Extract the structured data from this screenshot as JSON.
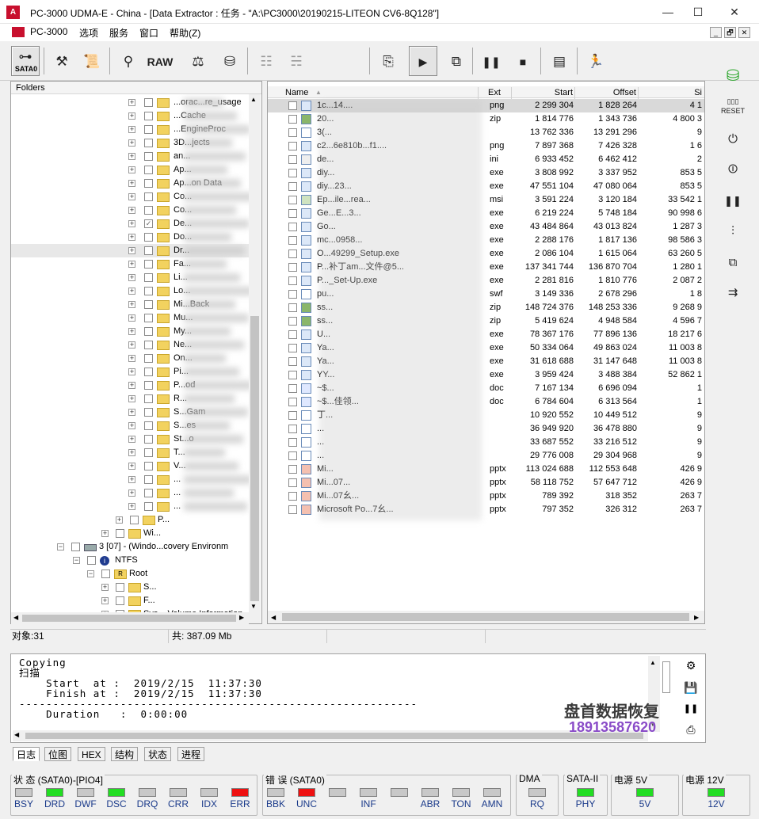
{
  "window": {
    "title": "PC-3000 UDMA-E - China - [Data Extractor : 任务 - \"A:\\PC3000\\20190215-LITEON CV6-8Q128\"]",
    "minimize": "—",
    "maximize": "☐",
    "close": "✕"
  },
  "menu": {
    "items": [
      "PC-3000",
      "选项",
      "服务",
      "窗口",
      "帮助(Z)"
    ]
  },
  "mdi": {
    "min": "_",
    "restore": "🗗",
    "close": "✕"
  },
  "toolbar": {
    "sata_label": "SATA0",
    "raw_label": "RAW"
  },
  "folders": {
    "header": "Folders",
    "rows": [
      {
        "label": "...orac...re_usage",
        "checked": false
      },
      {
        "label": "...Cache",
        "checked": false
      },
      {
        "label": "...EngineProc",
        "checked": false
      },
      {
        "label": "3D...jects",
        "checked": false
      },
      {
        "label": "an...",
        "checked": false
      },
      {
        "label": "Ap...",
        "checked": false
      },
      {
        "label": "Ap...on Data",
        "checked": false
      },
      {
        "label": "Co...",
        "checked": false
      },
      {
        "label": "Co...",
        "checked": false
      },
      {
        "label": "De...",
        "checked": true
      },
      {
        "label": "Do...",
        "checked": false
      },
      {
        "label": "Dr...",
        "checked": false
      },
      {
        "label": "Fa...",
        "checked": false
      },
      {
        "label": "Li...",
        "checked": false
      },
      {
        "label": "Lo...",
        "checked": false
      },
      {
        "label": "Mi...Back",
        "checked": false
      },
      {
        "label": "Mu...",
        "checked": false
      },
      {
        "label": "My...",
        "checked": false
      },
      {
        "label": "Ne...",
        "checked": false
      },
      {
        "label": "On...",
        "checked": false
      },
      {
        "label": "Pi...",
        "checked": false
      },
      {
        "label": "P...od",
        "checked": false
      },
      {
        "label": "R...",
        "checked": false
      },
      {
        "label": "S...Gam",
        "checked": false
      },
      {
        "label": "S...es",
        "checked": false
      },
      {
        "label": "St...o",
        "checked": false
      },
      {
        "label": "T...",
        "checked": false
      },
      {
        "label": "V...",
        "checked": false
      },
      {
        "label": "...",
        "checked": false
      },
      {
        "label": "...",
        "checked": false
      },
      {
        "label": "...",
        "checked": false
      }
    ],
    "tail": {
      "p_row": "P...",
      "win_row": "Wi...",
      "partition": "3 [07] - (Windo...covery Environm",
      "ntfs": "NTFS",
      "root": "Root",
      "s_row": "S...",
      "f_row": "F...",
      "svi": "Sys... Volume Information"
    }
  },
  "files": {
    "columns": [
      "Name",
      "Ext",
      "Start",
      "Offset",
      "Si"
    ],
    "rows": [
      {
        "name": "1c...14....",
        "ext": "png",
        "start": "2 299 304",
        "offset": "1 828 264",
        "size": "4 1"
      },
      {
        "name": "20...",
        "ext": "zip",
        "start": "1 814 776",
        "offset": "1 343 736",
        "size": "4 800 3"
      },
      {
        "name": "3(...",
        "ext": "",
        "start": "13 762 336",
        "offset": "13 291 296",
        "size": "9"
      },
      {
        "name": "c2...6e810b...f1....",
        "ext": "png",
        "start": "7 897 368",
        "offset": "7 426 328",
        "size": "1 6"
      },
      {
        "name": "de...",
        "ext": "ini",
        "start": "6 933 452",
        "offset": "6 462 412",
        "size": "2"
      },
      {
        "name": "diy...",
        "ext": "exe",
        "start": "3 808 992",
        "offset": "3 337 952",
        "size": "853 5"
      },
      {
        "name": "diy...23...",
        "ext": "exe",
        "start": "47 551 104",
        "offset": "47 080 064",
        "size": "853 5"
      },
      {
        "name": "Ep...ile...rea...",
        "ext": "msi",
        "start": "3 591 224",
        "offset": "3 120 184",
        "size": "33 542 1"
      },
      {
        "name": "Ge...E...3...",
        "ext": "exe",
        "start": "6 219 224",
        "offset": "5 748 184",
        "size": "90 998 6"
      },
      {
        "name": "Go...",
        "ext": "exe",
        "start": "43 484 864",
        "offset": "43 013 824",
        "size": "1 287 3"
      },
      {
        "name": "mc...0958...",
        "ext": "exe",
        "start": "2 288 176",
        "offset": "1 817 136",
        "size": "98 586 3"
      },
      {
        "name": "O...49299_Setup.exe",
        "ext": "exe",
        "start": "2 086 104",
        "offset": "1 615 064",
        "size": "63 260 5"
      },
      {
        "name": "P...补丁am...文件@5...",
        "ext": "exe",
        "start": "137 341 744",
        "offset": "136 870 704",
        "size": "1 280 1"
      },
      {
        "name": "P..._Set-Up.exe",
        "ext": "exe",
        "start": "2 281 816",
        "offset": "1 810 776",
        "size": "2 087 2"
      },
      {
        "name": "pu...",
        "ext": "swf",
        "start": "3 149 336",
        "offset": "2 678 296",
        "size": "1 8"
      },
      {
        "name": "ss...",
        "ext": "zip",
        "start": "148 724 376",
        "offset": "148 253 336",
        "size": "9 268 9"
      },
      {
        "name": "ss...",
        "ext": "zip",
        "start": "5 419 624",
        "offset": "4 948 584",
        "size": "4 596 7"
      },
      {
        "name": "U...",
        "ext": "exe",
        "start": "78 367 176",
        "offset": "77 896 136",
        "size": "18 217 6"
      },
      {
        "name": "Ya...",
        "ext": "exe",
        "start": "50 334 064",
        "offset": "49 863 024",
        "size": "11 003 8"
      },
      {
        "name": "Ya...",
        "ext": "exe",
        "start": "31 618 688",
        "offset": "31 147 648",
        "size": "11 003 8"
      },
      {
        "name": "YY...",
        "ext": "exe",
        "start": "3 959 424",
        "offset": "3 488 384",
        "size": "52 862 1"
      },
      {
        "name": "~$...",
        "ext": "doc",
        "start": "7 167 134",
        "offset": "6 696 094",
        "size": "1"
      },
      {
        "name": "~$...佳领...",
        "ext": "doc",
        "start": "6 784 604",
        "offset": "6 313 564",
        "size": "1"
      },
      {
        "name": "丁...",
        "ext": "",
        "start": "10 920 552",
        "offset": "10 449 512",
        "size": "9"
      },
      {
        "name": "...",
        "ext": "",
        "start": "36 949 920",
        "offset": "36 478 880",
        "size": "9"
      },
      {
        "name": "...",
        "ext": "",
        "start": "33 687 552",
        "offset": "33 216 512",
        "size": "9"
      },
      {
        "name": "...",
        "ext": "",
        "start": "29 776 008",
        "offset": "29 304 968",
        "size": "9"
      },
      {
        "name": "Mi...",
        "ext": "pptx",
        "start": "113 024 688",
        "offset": "112 553 648",
        "size": "426 9"
      },
      {
        "name": "Mi...07...",
        "ext": "pptx",
        "start": "58 118 752",
        "offset": "57 647 712",
        "size": "426 9"
      },
      {
        "name": "Mi...07幺...",
        "ext": "pptx",
        "start": "789 392",
        "offset": "318 352",
        "size": "263 7"
      },
      {
        "name": "Microsoft Po...7幺...",
        "ext": "pptx",
        "start": "797 352",
        "offset": "326 312",
        "size": "263 7"
      }
    ]
  },
  "statusbar": {
    "objects": "对象:31",
    "total": "共: 387.09 Mb"
  },
  "log": {
    "text": "Copying\n扫描\n    Start  at :  2019/2/15  11:37:30\n    Finish at :  2019/2/15  11:37:30\n-----------------------------------------------------------\n    Duration   :  0:00:00"
  },
  "watermark": {
    "line1": "盘首数据恢复",
    "line2": "18913587620"
  },
  "tabs": [
    "日志",
    "位图",
    "HEX",
    "结构",
    "状态",
    "进程"
  ],
  "led_groups": [
    {
      "title": "状 态 (SATA0)-[PIO4]",
      "leds": [
        {
          "label": "BSY",
          "color": "gray"
        },
        {
          "label": "DRD",
          "color": "green"
        },
        {
          "label": "DWF",
          "color": "gray"
        },
        {
          "label": "DSC",
          "color": "green"
        },
        {
          "label": "DRQ",
          "color": "gray"
        },
        {
          "label": "CRR",
          "color": "gray"
        },
        {
          "label": "IDX",
          "color": "gray"
        },
        {
          "label": "ERR",
          "color": "red"
        }
      ]
    },
    {
      "title": "错 误 (SATA0)",
      "leds": [
        {
          "label": "BBK",
          "color": "gray"
        },
        {
          "label": "UNC",
          "color": "red"
        },
        {
          "label": "",
          "color": "gray"
        },
        {
          "label": "INF",
          "color": "gray"
        },
        {
          "label": "",
          "color": "gray"
        },
        {
          "label": "ABR",
          "color": "gray"
        },
        {
          "label": "TON",
          "color": "gray"
        },
        {
          "label": "AMN",
          "color": "gray"
        }
      ]
    },
    {
      "title": "DMA",
      "leds": [
        {
          "label": "RQ",
          "color": "gray"
        }
      ]
    },
    {
      "title": "SATA-II",
      "leds": [
        {
          "label": "PHY",
          "color": "green"
        }
      ]
    },
    {
      "title": "电源 5V",
      "leds": [
        {
          "label": "5V",
          "color": "green"
        }
      ]
    },
    {
      "title": "电源 12V",
      "leds": [
        {
          "label": "12V",
          "color": "green"
        }
      ]
    }
  ],
  "colors": {
    "led_green": "#22dd22",
    "led_red": "#ee1111",
    "led_gray": "#c8c8c8",
    "label_blue": "#1a3a8a",
    "watermark_purple": "#8a4cc8"
  }
}
